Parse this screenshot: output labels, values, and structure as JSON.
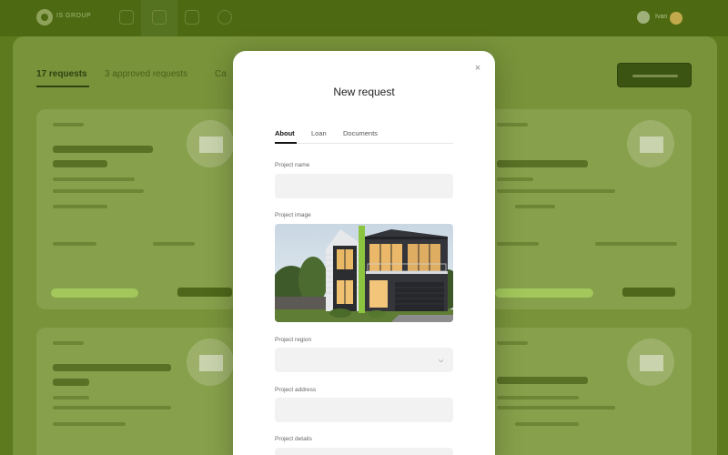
{
  "app": {
    "logo_text": "IS GROUP",
    "user_name": "Ivan"
  },
  "background": {
    "tabs": [
      "17 requests",
      "3 approved requests",
      "Ca"
    ]
  },
  "modal": {
    "title": "New request",
    "close_glyph": "×",
    "tabs": [
      {
        "label": "About",
        "active": true
      },
      {
        "label": "Loan",
        "active": false
      },
      {
        "label": "Documents",
        "active": false
      }
    ],
    "fields": {
      "project_name": {
        "label": "Project name",
        "value": "",
        "placeholder": ""
      },
      "project_image": {
        "label": "Project image"
      },
      "project_region": {
        "label": "Project region",
        "value": ""
      },
      "project_address": {
        "label": "Project address",
        "value": "",
        "placeholder": ""
      },
      "project_details": {
        "label": "Project details",
        "value": "",
        "placeholder": ""
      }
    }
  },
  "icons": {
    "close": "close-icon",
    "select": "chevron-down-icon"
  },
  "colors": {
    "overlay_green": "#5e7a1f",
    "modal_bg": "#ffffff",
    "input_bg": "#f2f2f2",
    "accent_lime": "#a3c75b"
  }
}
